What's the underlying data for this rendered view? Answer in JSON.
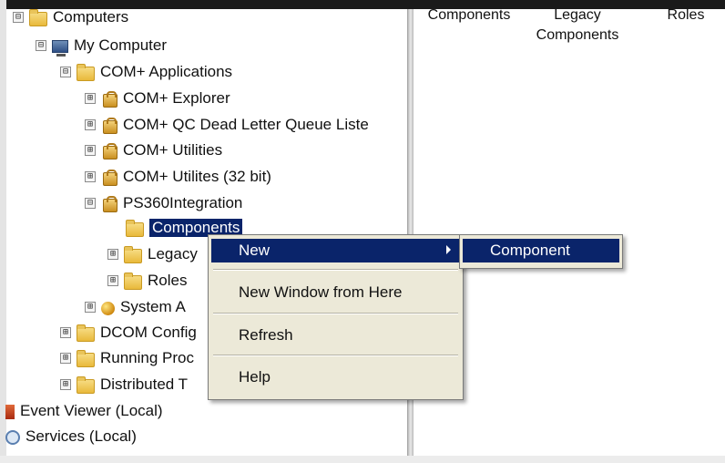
{
  "tree": {
    "items": [
      {
        "label": "Computers",
        "toggle": "⊟",
        "icon": "folder-icon"
      },
      {
        "label": "My Computer",
        "toggle": "⊟",
        "icon": "computer-icon"
      },
      {
        "label": "COM+ Applications",
        "toggle": "⊟",
        "icon": "folder-icon"
      },
      {
        "label": "COM+ Explorer",
        "toggle": "⊞",
        "icon": "package-icon"
      },
      {
        "label": "COM+ QC Dead Letter Queue Liste",
        "toggle": "⊞",
        "icon": "package-icon"
      },
      {
        "label": "COM+ Utilities",
        "toggle": "⊞",
        "icon": "package-icon"
      },
      {
        "label": "COM+ Utilites (32 bit)",
        "toggle": "⊞",
        "icon": "package-icon"
      },
      {
        "label": "PS360Integration",
        "toggle": "⊟",
        "icon": "package-icon"
      },
      {
        "label": "Components",
        "toggle": "",
        "icon": "folder-icon",
        "selected": true
      },
      {
        "label": "Legacy",
        "toggle": "⊞",
        "icon": "folder-icon"
      },
      {
        "label": "Roles",
        "toggle": "⊞",
        "icon": "folder-icon"
      },
      {
        "label": "System A",
        "toggle": "⊞",
        "icon": "globe-icon"
      },
      {
        "label": "DCOM Config",
        "toggle": "⊞",
        "icon": "folder-icon"
      },
      {
        "label": "Running Proc",
        "toggle": "⊞",
        "icon": "folder-icon"
      },
      {
        "label": "Distributed T",
        "toggle": "⊞",
        "icon": "folder-icon"
      },
      {
        "label": "Event Viewer (Local)",
        "toggle": "",
        "icon": "event-viewer-icon"
      },
      {
        "label": "Services (Local)",
        "toggle": "",
        "icon": "services-icon"
      }
    ]
  },
  "columns": [
    "Components",
    "Legacy Components",
    "Roles"
  ],
  "context_menu": {
    "items": [
      "New",
      "New Window from Here",
      "Refresh",
      "Help"
    ],
    "highlighted": "New"
  },
  "submenu": {
    "items": [
      "Component"
    ]
  },
  "colors": {
    "selection": "#0a246a",
    "menu_bg": "#ece9d8"
  }
}
